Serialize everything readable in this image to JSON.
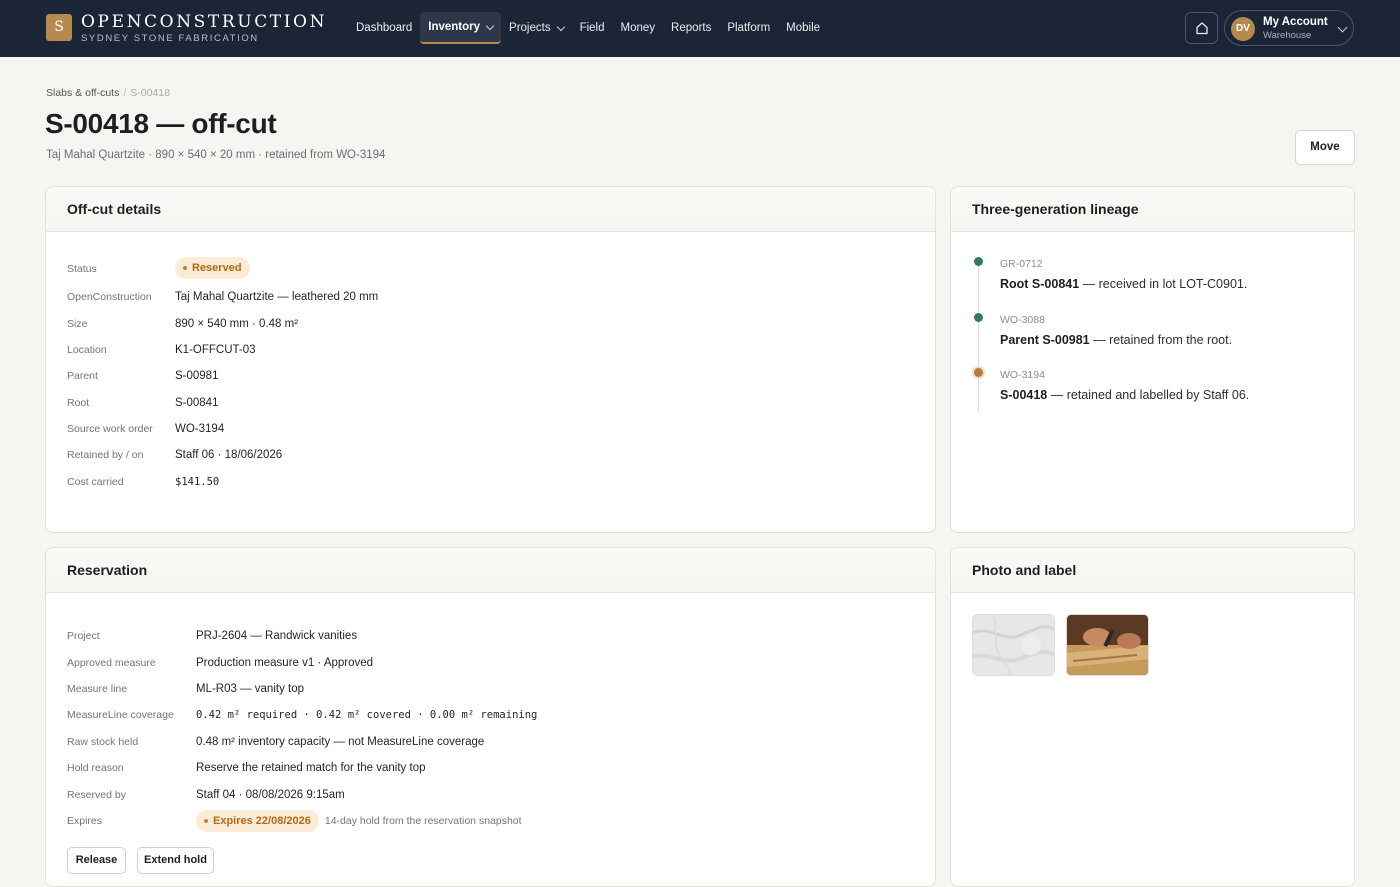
{
  "brand": {
    "logo_letter": "S",
    "name": "OPENCONSTRUCTION",
    "subtitle": "SYDNEY STONE FABRICATION"
  },
  "nav": [
    {
      "label": "Dashboard",
      "dropdown": false,
      "active": false
    },
    {
      "label": "Inventory",
      "dropdown": true,
      "active": true
    },
    {
      "label": "Projects",
      "dropdown": true,
      "active": false
    },
    {
      "label": "Field",
      "dropdown": false,
      "active": false
    },
    {
      "label": "Money",
      "dropdown": false,
      "active": false
    },
    {
      "label": "Reports",
      "dropdown": false,
      "active": false
    },
    {
      "label": "Platform",
      "dropdown": false,
      "active": false
    },
    {
      "label": "Mobile",
      "dropdown": false,
      "active": false
    }
  ],
  "account": {
    "initials": "DV",
    "name": "My Account",
    "role": "Warehouse"
  },
  "breadcrumb": {
    "parent": "Slabs & off-cuts",
    "separator": "/",
    "current": "S-00418"
  },
  "page": {
    "title": "S-00418 — off-cut",
    "subtitle": "Taj Mahal Quartzite · 890 × 540 × 20 mm · retained from WO-3194",
    "move_label": "Move"
  },
  "details": {
    "title": "Off-cut details",
    "status_label": "Status",
    "status_badge": "Reserved",
    "rows": [
      {
        "label": "OpenConstruction",
        "value": "Taj Mahal Quartzite — leathered 20 mm"
      },
      {
        "label": "Size",
        "value": "890 × 540 mm · 0.48 m²"
      },
      {
        "label": "Location",
        "value": "K1-OFFCUT-03"
      },
      {
        "label": "Parent",
        "value": "S-00981"
      },
      {
        "label": "Root",
        "value": "S-00841"
      },
      {
        "label": "Source work order",
        "value": "WO-3194"
      },
      {
        "label": "Retained by / on",
        "value": "Staff 06 · 18/06/2026"
      },
      {
        "label": "Cost carried",
        "value": "$141.50"
      }
    ]
  },
  "lineage": {
    "title": "Three-generation lineage",
    "items": [
      {
        "code": "GR-0712",
        "bold": "Root S-00841",
        "text": " — received in lot LOT-C0901.",
        "color": "#2f7d5b"
      },
      {
        "code": "WO-3088",
        "bold": "Parent S-00981",
        "text": " — retained from the root.",
        "color": "#2f7d5b"
      },
      {
        "code": "WO-3194",
        "bold": "S-00418",
        "text": " — retained and labelled by Staff 06.",
        "color": "#b57a3c"
      }
    ]
  },
  "reservation": {
    "title": "Reservation",
    "rows": [
      {
        "label": "Project",
        "value": "PRJ-2604 — Randwick vanities"
      },
      {
        "label": "Approved measure",
        "value": "Production measure v1 · Approved"
      },
      {
        "label": "Measure line",
        "value": "ML-R03 — vanity top"
      },
      {
        "label": "MeasureLine coverage",
        "value": "0.42 m² required · 0.42 m² covered · 0.00 m² remaining"
      },
      {
        "label": "Raw stock held",
        "value": "0.48 m² inventory capacity — not MeasureLine coverage"
      },
      {
        "label": "Hold reason",
        "value": "Reserve the retained match for the vanity top"
      },
      {
        "label": "Reserved by",
        "value": "Staff 04 · 08/08/2026 9:15am"
      }
    ],
    "expires_label": "Expires",
    "expires_badge": "Expires 22/08/2026",
    "expires_hint": "14-day hold from the reservation snapshot",
    "release_label": "Release",
    "extend_label": "Extend hold"
  },
  "photos": {
    "title": "Photo and label"
  },
  "colors": {
    "topbar": "#1c2536",
    "accent": "#b58a4e",
    "badge_bg": "#fbecd7",
    "badge_text": "#b36a16",
    "green": "#2f7d5b"
  }
}
